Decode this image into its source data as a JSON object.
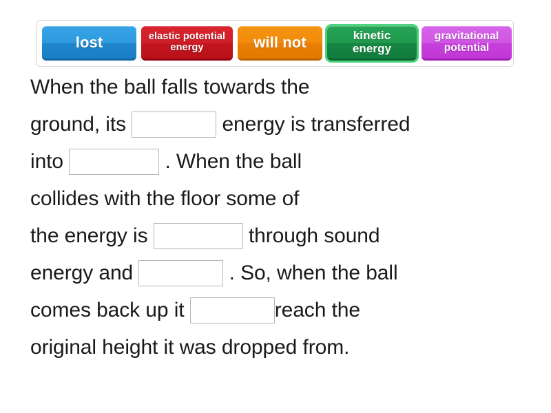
{
  "wordbank": {
    "tiles": [
      {
        "label": "lost",
        "color": "#2e9ade",
        "key": "lost"
      },
      {
        "label": "elastic potential energy",
        "color": "#cf1f29",
        "key": "elastic"
      },
      {
        "label": "will not",
        "color": "#f28a0a",
        "key": "willnot"
      },
      {
        "label": "kinetic energy",
        "color": "#1f9a4c",
        "key": "kinetic"
      },
      {
        "label": "gravitational potential",
        "color": "#cf55e3",
        "key": "gravitational"
      }
    ]
  },
  "sentence": {
    "line1": {
      "a": "When the ball falls towards the"
    },
    "line2": {
      "a": "ground, its ",
      "b": " energy is transferred"
    },
    "line3": {
      "a": "into ",
      "b": " . When the ball"
    },
    "line4": {
      "a": "collides with the floor some of"
    },
    "line5": {
      "a": "the energy is ",
      "b": " through sound"
    },
    "line6": {
      "a": "energy and ",
      "b": " . So, when the ball"
    },
    "line7": {
      "a": "comes back up it ",
      "b": "reach the"
    },
    "line8": {
      "a": "original height it was dropped from."
    },
    "blanks": {
      "blank1_value": "",
      "blank2_value": "",
      "blank3_value": "",
      "blank4_value": "",
      "blank5_value": ""
    }
  }
}
